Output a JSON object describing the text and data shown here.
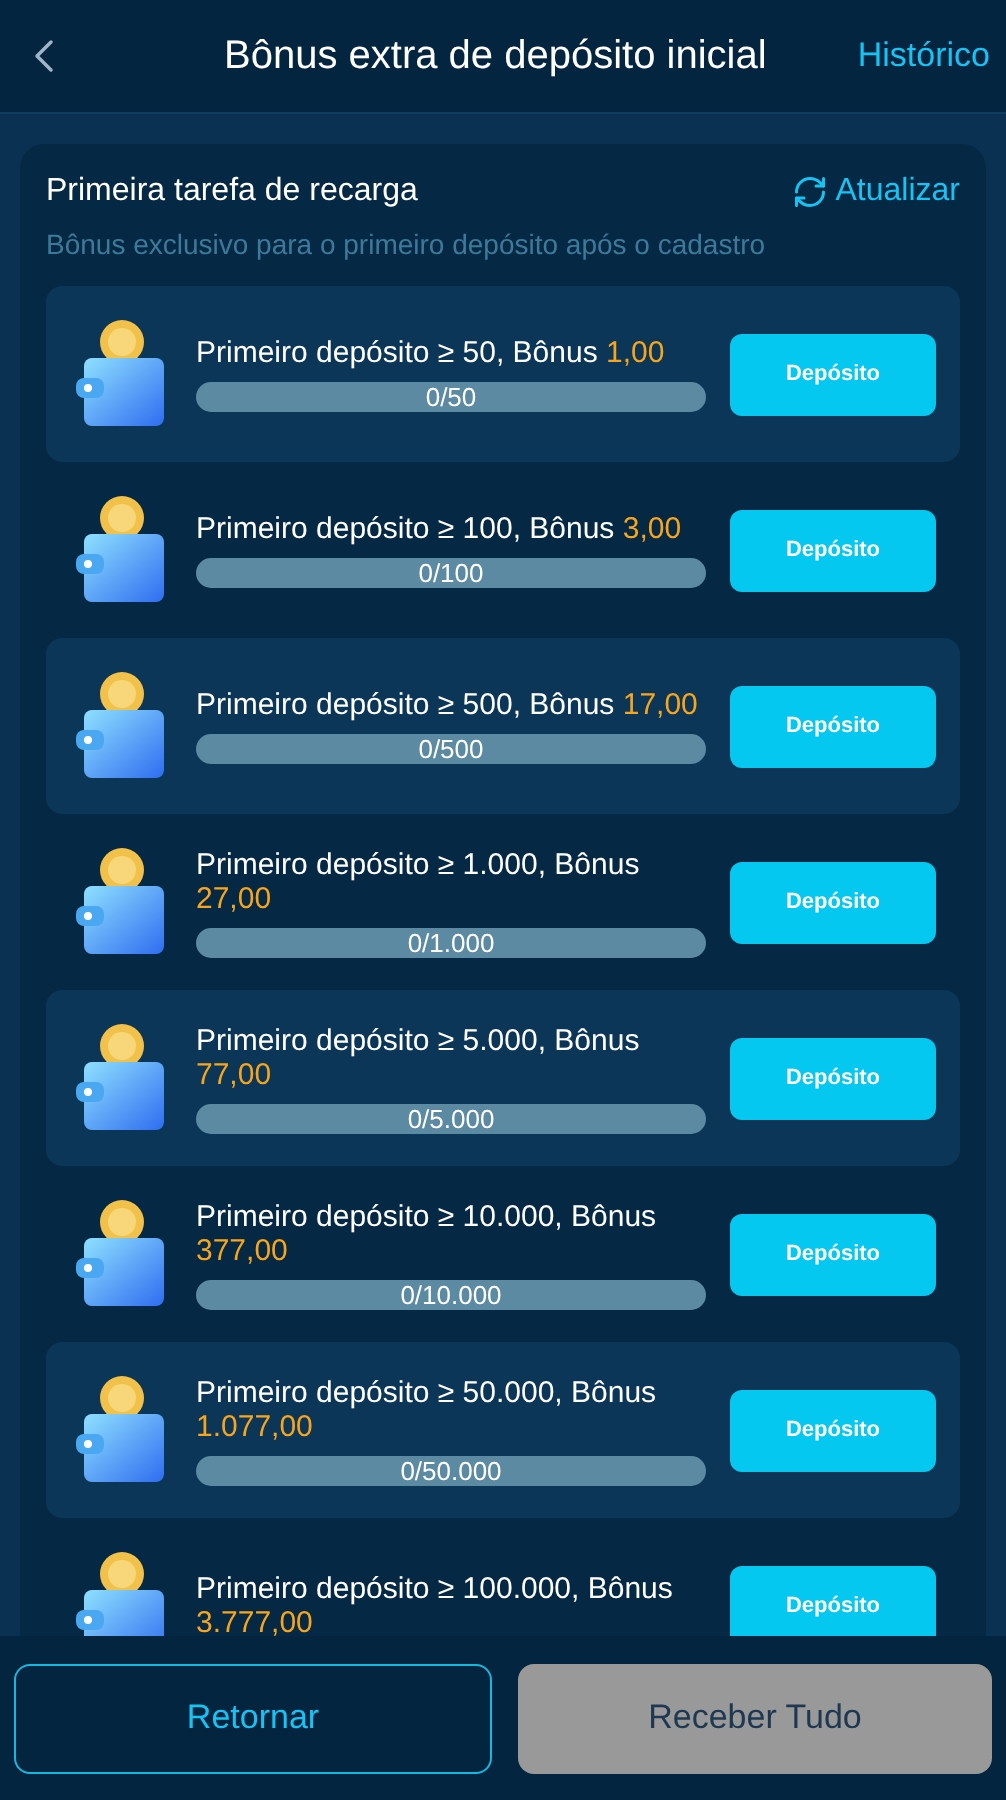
{
  "header": {
    "title": "Bônus extra de depósito inicial",
    "link": "Histórico"
  },
  "section": {
    "title": "Primeira tarefa de recarga",
    "refresh": "Atualizar",
    "subtitle": "Bônus exclusivo para o primeiro depósito após o cadastro"
  },
  "tasks": [
    {
      "label": "Primeiro depósito ≥ 50, Bônus",
      "bonus": "1,00",
      "progress": "0/50",
      "level": 0,
      "button": "Depósito"
    },
    {
      "label": "Primeiro depósito ≥ 100, Bônus",
      "bonus": "3,00",
      "progress": "0/100",
      "level": 0,
      "button": "Depósito"
    },
    {
      "label": "Primeiro depósito ≥ 500, Bônus",
      "bonus": "17,00",
      "progress": "0/500",
      "level": 0,
      "button": "Depósito"
    },
    {
      "label": "Primeiro depósito ≥ 1.000, Bônus",
      "bonus": "27,00",
      "progress": "0/1.000",
      "level": 0,
      "button": "Depósito"
    },
    {
      "label": "Primeiro depósito ≥ 5.000, Bônus",
      "bonus": "77,00",
      "progress": "0/5.000",
      "level": 0,
      "button": "Depósito"
    },
    {
      "label": "Primeiro depósito ≥ 10.000, Bônus",
      "bonus": "377,00",
      "progress": "0/10.000",
      "level": 0,
      "button": "Depósito"
    },
    {
      "label": "Primeiro depósito ≥ 50.000, Bônus",
      "bonus": "1.077,00",
      "progress": "0/50.000",
      "level": 0,
      "button": "Depósito"
    },
    {
      "label": "Primeiro depósito ≥ 100.000, Bônus",
      "bonus": "3.777,00",
      "button": "Depósito"
    }
  ],
  "footer": {
    "back": "Retornar",
    "claim": "Receber Tudo",
    "claim_disabled": true
  }
}
